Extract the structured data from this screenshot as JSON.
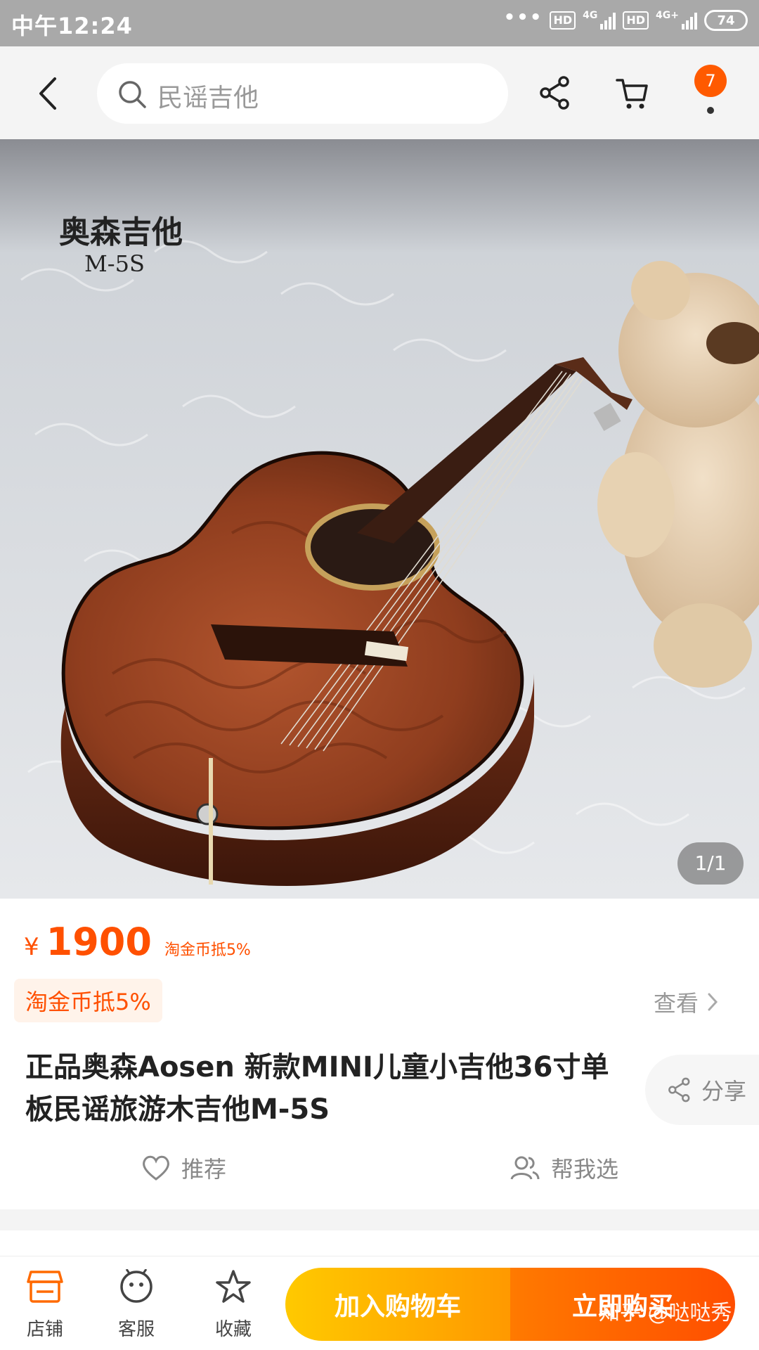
{
  "status_bar": {
    "time": "中午12:24",
    "dots": "•••",
    "hd1": "HD",
    "net1": "4G",
    "hd2": "HD",
    "net2": "4G+",
    "battery": "74"
  },
  "header": {
    "search_placeholder": "民谣吉他",
    "cart_badge": "7"
  },
  "product_image": {
    "brand_text": "奥森吉他",
    "model_text": "M-5S",
    "counter": "1/1"
  },
  "info": {
    "price_symbol": "¥",
    "price": "1900",
    "price_tag": "淘金币抵5%",
    "coin_tag": "淘金币抵5%",
    "view_label": "查看",
    "title": "正品奥森Aosen 新款MINI儿童小吉他36寸单板民谣旅游木吉他M-5S",
    "share_label": "分享",
    "recommend_label": "推荐",
    "help_pick_label": "帮我选"
  },
  "bottom_bar": {
    "shop_label": "店铺",
    "service_label": "客服",
    "favorite_label": "收藏",
    "add_cart_label": "加入购物车",
    "buy_now_label": "立即购买"
  },
  "watermark": "知乎 @哒哒秀",
  "colors": {
    "accent": "#ff5000",
    "cart_button": "#ffb000",
    "buy_button": "#ff6000"
  },
  "icons": [
    "back-icon",
    "search-icon",
    "share-icon",
    "cart-icon",
    "shop-icon",
    "service-icon",
    "star-icon",
    "heart-icon",
    "people-icon",
    "chevron-right-icon"
  ]
}
